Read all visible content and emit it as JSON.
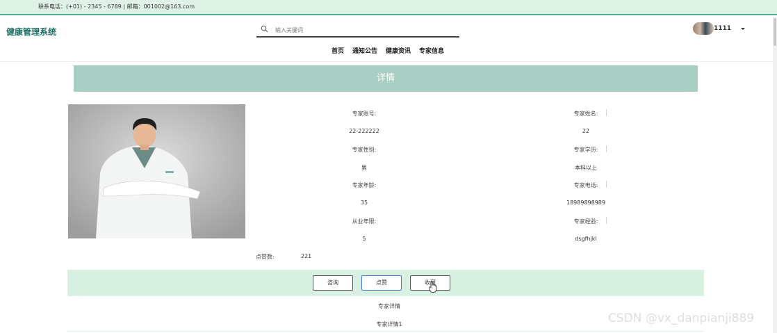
{
  "topbar": {
    "contact": "联系电话：(+01) - 2345 - 6789 | 邮箱：001002@163.com"
  },
  "header": {
    "logo": "健康管理系统",
    "search_placeholder": "输入关键词",
    "user_name": "1111"
  },
  "nav": {
    "items": [
      "首页",
      "通知公告",
      "健康资讯",
      "专家信息"
    ]
  },
  "banner": {
    "title": "详情"
  },
  "details": {
    "account_label": "专家账号:",
    "account_value": "22-222222",
    "name_label": "专家姓名:",
    "name_value": "22",
    "gender_label": "专家性别:",
    "gender_value": "男",
    "education_label": "专家学历:",
    "education_value": "本科以上",
    "age_label": "专家年龄:",
    "age_value": "35",
    "phone_label": "专家电话:",
    "phone_value": "18989898989",
    "years_label": "从业年限:",
    "years_value": "5",
    "experience_label": "专家经验:",
    "experience_value": "dsgfhjkl",
    "likes_label": "点赞数:",
    "likes_value": "221"
  },
  "actions": {
    "consult": "咨询",
    "like": "点赞",
    "favorite": "收藏"
  },
  "detail_section": {
    "title": "专家详情",
    "body": "专家详情1"
  },
  "watermark": "CSDN @vx_danpianji889",
  "colors": {
    "accent": "#4fae95",
    "banner": "#a9cfc4",
    "action_bar": "#d9f1e2",
    "logo": "#1f6f66"
  }
}
